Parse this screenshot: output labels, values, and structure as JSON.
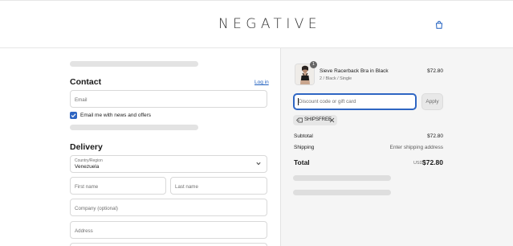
{
  "header": {
    "logo_text": "NEGATIVE",
    "bag_icon": "shopping-bag-icon"
  },
  "contact": {
    "heading": "Contact",
    "login_link": "Log in",
    "email_placeholder": "Email",
    "newsletter_label": "Email me with news and offers",
    "newsletter_checked": true
  },
  "delivery": {
    "heading": "Delivery",
    "country_label": "Country/Region",
    "country_value": "Venezuela",
    "first_name_placeholder": "First name",
    "last_name_placeholder": "Last name",
    "company_placeholder": "Company (optional)",
    "address_placeholder": "Address"
  },
  "order": {
    "item": {
      "name": "Sieve Racerback Bra in Black",
      "variant": "2 / Black / Single",
      "price": "$72.80",
      "quantity": "1"
    },
    "discount_placeholder": "Discount code or gift card",
    "apply_label": "Apply",
    "applied_code": "SHIPSFREE",
    "subtotal_label": "Subtotal",
    "subtotal_value": "$72.80",
    "shipping_label": "Shipping",
    "shipping_value": "Enter shipping address",
    "total_label": "Total",
    "currency": "USD",
    "total_value": "$72.80"
  },
  "colors": {
    "accent": "#2f66c3",
    "summary_bg": "#f5f5f5"
  }
}
